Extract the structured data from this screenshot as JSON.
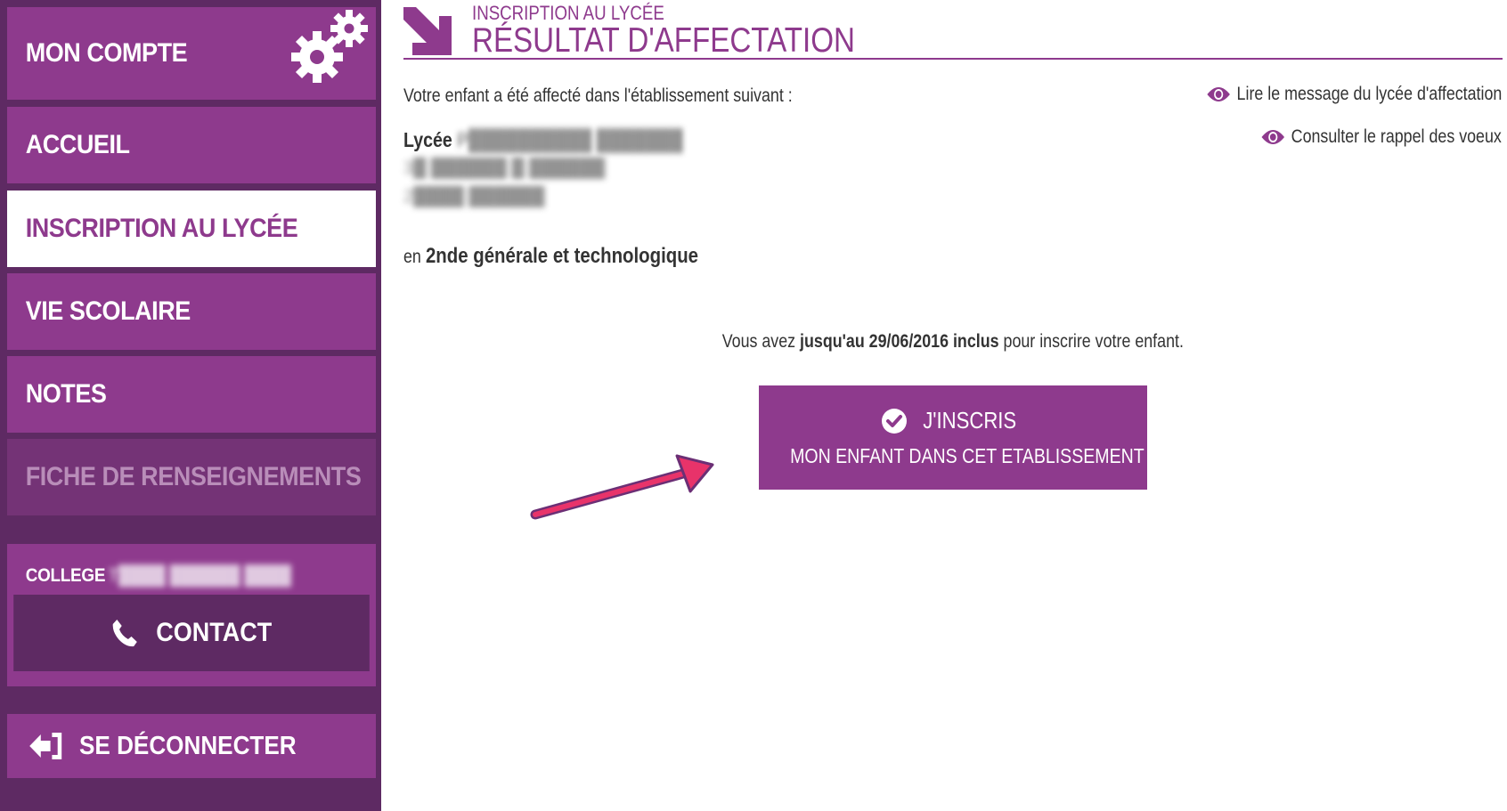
{
  "sidebar": {
    "account_label": "MON COMPTE",
    "items": [
      {
        "label": "ACCUEIL"
      },
      {
        "label": "INSCRIPTION AU LYCÉE"
      },
      {
        "label": "VIE SCOLAIRE"
      },
      {
        "label": "NOTES"
      },
      {
        "label": "FICHE DE RENSEIGNEMENTS"
      }
    ],
    "college_prefix": "COLLEGE",
    "college_name_redacted": "T████ ██████ ████",
    "contact_label": "CONTACT",
    "logout_label": "SE DÉCONNECTER"
  },
  "header": {
    "kicker": "INSCRIPTION AU LYCÉE",
    "title": "RÉSULTAT D'AFFECTATION"
  },
  "main": {
    "intro": "Votre enfant a été affecté dans l'établissement suivant :",
    "school_prefix": "Lycée",
    "school_name_redacted": "P██████████ ███████",
    "address_line1_redacted": "3█ ██████ █ ██████",
    "address_line2_redacted": "2████ ██████",
    "track_prefix": "en",
    "track": "2nde générale et technologique",
    "link_message": "Lire le message du lycée d'affectation",
    "link_voeux": "Consulter le rappel des voeux",
    "deadline_before": "Vous avez ",
    "deadline_bold": "jusqu'au 29/06/2016 inclus",
    "deadline_after": " pour inscrire votre enfant.",
    "cta_line1": "J'INSCRIS",
    "cta_line2": "MON ENFANT DANS CET ETABLISSEMENT"
  },
  "colors": {
    "brand_purple": "#8e3a8d",
    "sidebar_dark": "#5e2a63",
    "annotation_arrow": "#e8336a"
  },
  "icons": {
    "account": "gears-icon",
    "contact": "phone-icon",
    "logout": "sign-out-icon",
    "header": "arrow-down-right-icon",
    "links": "eye-icon",
    "cta": "check-circle-icon"
  }
}
